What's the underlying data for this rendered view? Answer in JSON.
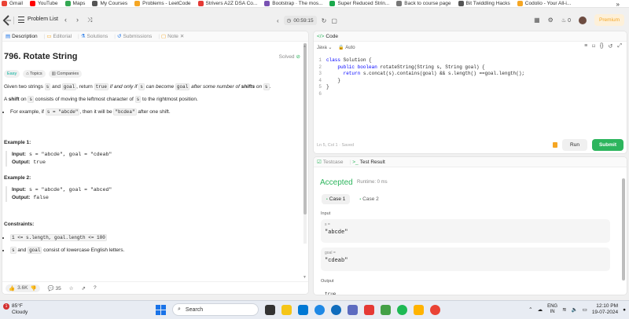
{
  "bookmarks": [
    {
      "label": "Gmail",
      "color": "#ea4335"
    },
    {
      "label": "YouTube",
      "color": "#ff0000"
    },
    {
      "label": "Maps",
      "color": "#34a853"
    },
    {
      "label": "My Courses",
      "color": "#555555"
    },
    {
      "label": "Problems - LeetCode",
      "color": "#f5a623"
    },
    {
      "label": "Strivers A2Z DSA Co...",
      "color": "#e53935"
    },
    {
      "label": "Bootstrap · The mos...",
      "color": "#7952b3"
    },
    {
      "label": "Super Reduced Strin...",
      "color": "#1ba94c"
    },
    {
      "label": "Back to course page",
      "color": "#777777"
    },
    {
      "label": "Bit Twiddling Hacks",
      "color": "#555555"
    },
    {
      "label": "Codolio - Your All-i...",
      "color": "#f5a623"
    }
  ],
  "nav": {
    "problem_list": "Problem List",
    "timer": "00:59:15",
    "streak": "0",
    "premium": "Premium"
  },
  "left": {
    "tabs": [
      "Description",
      "Editorial",
      "Solutions",
      "Submissions",
      "Note"
    ],
    "title": "796. Rotate String",
    "solved": "Solved",
    "chips": [
      "Easy",
      "Topics",
      "Companies"
    ],
    "desc_text1": "Given two strings ",
    "desc_s": "s",
    "desc_and": " and ",
    "desc_goal": "goal",
    "desc_return": ", return ",
    "desc_true": "true",
    "desc_italic": " if and only if ",
    "desc_s2": "s",
    "desc_italic2": " can become ",
    "desc_goal2": "goal",
    "desc_italic3": " after some number of ",
    "desc_shifts": "shifts",
    "desc_on": " on ",
    "desc_s3": "s",
    "desc_end": ".",
    "shift_a": "A ",
    "shift_word": "shift",
    "shift_on": " on ",
    "shift_s": "s",
    "shift_rest": " consists of moving the leftmost character of ",
    "shift_s2": "s",
    "shift_rest2": " to the rightmost position.",
    "bullet_pre": "For example, if ",
    "bullet_code1": "s = \"abcde\"",
    "bullet_mid": ", then it will be ",
    "bullet_code2": "\"bcdea\"",
    "bullet_end": " after one shift.",
    "ex1_title": "Example 1:",
    "ex1_input_label": "Input:",
    "ex1_input": "s = \"abcde\", goal = \"cdeab\"",
    "ex1_output_label": "Output:",
    "ex1_output": "true",
    "ex2_title": "Example 2:",
    "ex2_input_label": "Input:",
    "ex2_input": "s = \"abcde\", goal = \"abced\"",
    "ex2_output_label": "Output:",
    "ex2_output": "false",
    "constraints_title": "Constraints:",
    "c1": "1 <= s.length, goal.length <= 100",
    "c2_code1": "s",
    "c2_and": " and ",
    "c2_code2": "goal",
    "c2_rest": " consist of lowercase English letters.",
    "likes": "3.6K",
    "comments": "35"
  },
  "code": {
    "tab": "Code",
    "lang": "Java",
    "auto": "Auto",
    "lines": [
      {
        "n": "1",
        "html_kw": "class",
        "rest": " Solution {"
      },
      {
        "n": "2",
        "html_kw": "    public boolean",
        "rest": " rotateString(String s, String goal) {"
      },
      {
        "n": "3",
        "html_kw": "      return",
        "rest": " s.concat(s).contains(goal) && s.length() ==goal.length();"
      },
      {
        "n": "4",
        "html_kw": "",
        "rest": "    }"
      },
      {
        "n": "5",
        "html_kw": "",
        "rest": "}"
      },
      {
        "n": "6",
        "html_kw": "",
        "rest": ""
      }
    ],
    "status": "Ln 5, Col 1  ·  Saved",
    "run": "Run",
    "submit": "Submit"
  },
  "test": {
    "tabs": [
      "Testcase",
      "Test Result"
    ],
    "status": "Accepted",
    "runtime": "Runtime: 0 ms",
    "cases": [
      "Case 1",
      "Case 2"
    ],
    "input_label": "Input",
    "s_key": "s =",
    "s_val": "\"abcde\"",
    "goal_key": "goal =",
    "goal_val": "\"cdeab\"",
    "output_label": "Output",
    "output_peek": "true"
  },
  "taskbar": {
    "temp": "85°F",
    "weather": "Cloudy",
    "search": "Search",
    "lang1": "ENG",
    "lang2": "IN",
    "time": "12:10 PM",
    "date": "19-07-2024"
  }
}
